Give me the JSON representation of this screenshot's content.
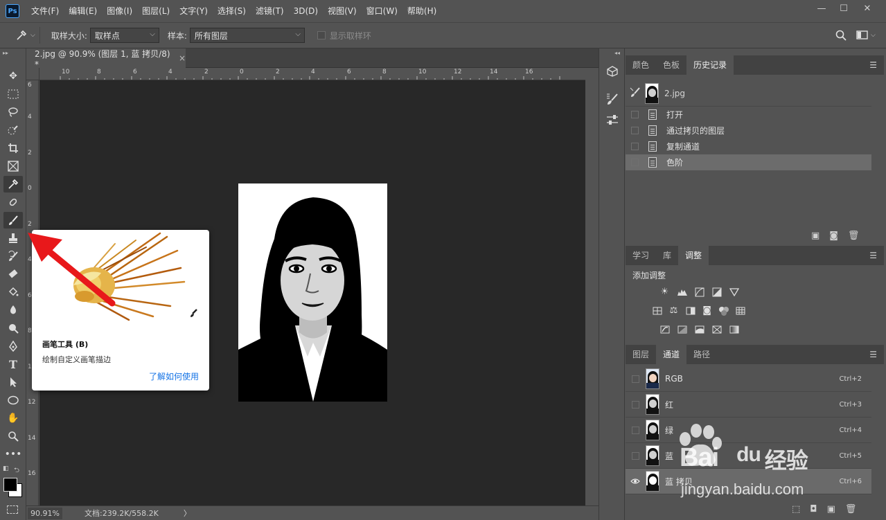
{
  "app": {
    "logo": "Ps"
  },
  "menu": [
    "文件(F)",
    "编辑(E)",
    "图像(I)",
    "图层(L)",
    "文字(Y)",
    "选择(S)",
    "滤镜(T)",
    "3D(D)",
    "视图(V)",
    "窗口(W)",
    "帮助(H)"
  ],
  "window_controls": {
    "minimize": "—",
    "restore": "☐",
    "close": "✕"
  },
  "options": {
    "sample_size_label": "取样大小:",
    "sample_size_value": "取样点",
    "sample_label": "样本:",
    "sample_value": "所有图层",
    "show_ring_label": "显示取样环"
  },
  "document": {
    "tab_title": "2.jpg @ 90.9% (图层 1, 蓝 拷贝/8) *",
    "tab_close": "×",
    "ruler_h": [
      "10",
      "8",
      "6",
      "4",
      "2",
      "0",
      "2",
      "4",
      "6",
      "8",
      "10",
      "12",
      "14",
      "16"
    ],
    "ruler_v": [
      "6",
      "4",
      "2",
      "0",
      "2",
      "4",
      "6",
      "8",
      "10",
      "12",
      "14",
      "16"
    ],
    "status_zoom": "90.91%",
    "status_doc": "文档:239.2K/558.2K",
    "status_arrow": "〉"
  },
  "tooltip": {
    "title": "画笔工具 (B)",
    "description": "绘制自定义画笔描边",
    "link": "了解如何使用"
  },
  "history_panel": {
    "tabs": [
      "颜色",
      "色板",
      "历史记录"
    ],
    "active_tab": 2,
    "snapshot": "2.jpg",
    "items": [
      "打开",
      "通过拷贝的图层",
      "复制通道",
      "色阶"
    ],
    "selected_index": 3
  },
  "adjust_panel": {
    "tabs": [
      "学习",
      "库",
      "调整"
    ],
    "active_tab": 2,
    "heading": "添加调整"
  },
  "channels_panel": {
    "tabs": [
      "图层",
      "通道",
      "路径"
    ],
    "active_tab": 1,
    "channels": [
      {
        "name": "RGB",
        "shortcut": "Ctrl+2"
      },
      {
        "name": "红",
        "shortcut": "Ctrl+3"
      },
      {
        "name": "绿",
        "shortcut": "Ctrl+4"
      },
      {
        "name": "蓝",
        "shortcut": "Ctrl+5"
      },
      {
        "name": "蓝 拷贝",
        "shortcut": "Ctrl+6"
      }
    ],
    "selected_index": 4
  },
  "watermark": {
    "brand": "Bai",
    "brand2": "du",
    "suffix": "经验",
    "url": "jingyan.baidu.com"
  },
  "colors": {
    "ps_blue": "#4aa7ff",
    "arrow_red": "#e8181b",
    "link_blue": "#1473e6"
  }
}
